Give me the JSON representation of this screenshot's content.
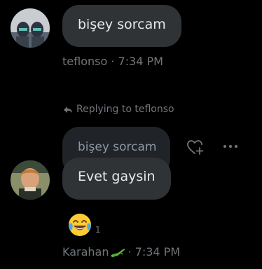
{
  "messages": [
    {
      "author": "teflonso",
      "text": "bişey sorcam",
      "meta": "teflonso · 7:34 PM"
    },
    {
      "replying_to": "Replying to teflonso",
      "quoted_text": "bişey sorcam",
      "text": "Evet gaysin",
      "reaction": {
        "emoji": "😂",
        "count": "1"
      },
      "author_name": "Karahan",
      "time": "· 7:34 PM"
    }
  ],
  "actions": {
    "react_icon": "heart-plus-icon",
    "more_icon": "more-horizontal-icon"
  },
  "colors": {
    "bubble": "#2f3336",
    "quoted_bubble": "#202327",
    "muted_text": "#71767b",
    "text": "#e7e9ea",
    "background": "#000000"
  }
}
